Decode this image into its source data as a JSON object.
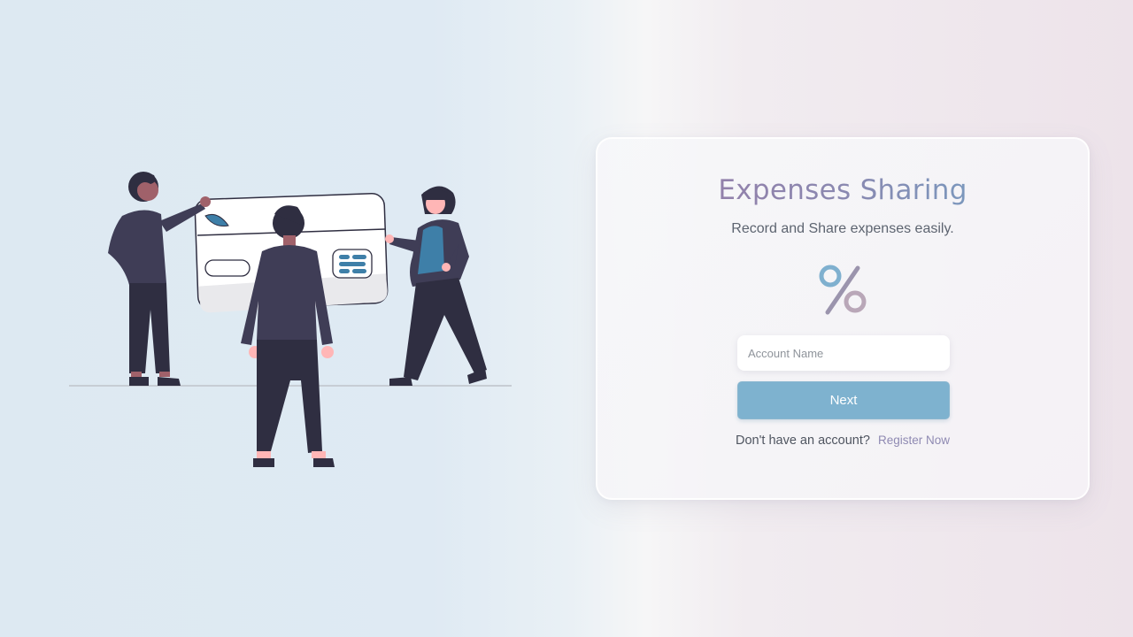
{
  "illustration": {
    "icon": "people-with-credit-card-illustration"
  },
  "login_card": {
    "title": "Expenses Sharing",
    "subtitle": "Record and Share expenses easily.",
    "logo_icon": "percent-icon",
    "account_input": {
      "placeholder": "Account Name",
      "value": ""
    },
    "next_label": "Next",
    "register_prompt": "Don't have an account?",
    "register_link": "Register Now"
  },
  "colors": {
    "title_gradient_start": "#9b7aa6",
    "title_gradient_end": "#6ea6c9",
    "button": "#7eb2cf",
    "link": "#8f8ab2",
    "percent_circle_top": "#7fb0cf",
    "percent_circle_bottom": "#b9a7b8",
    "percent_slash": "#9b94ad"
  }
}
